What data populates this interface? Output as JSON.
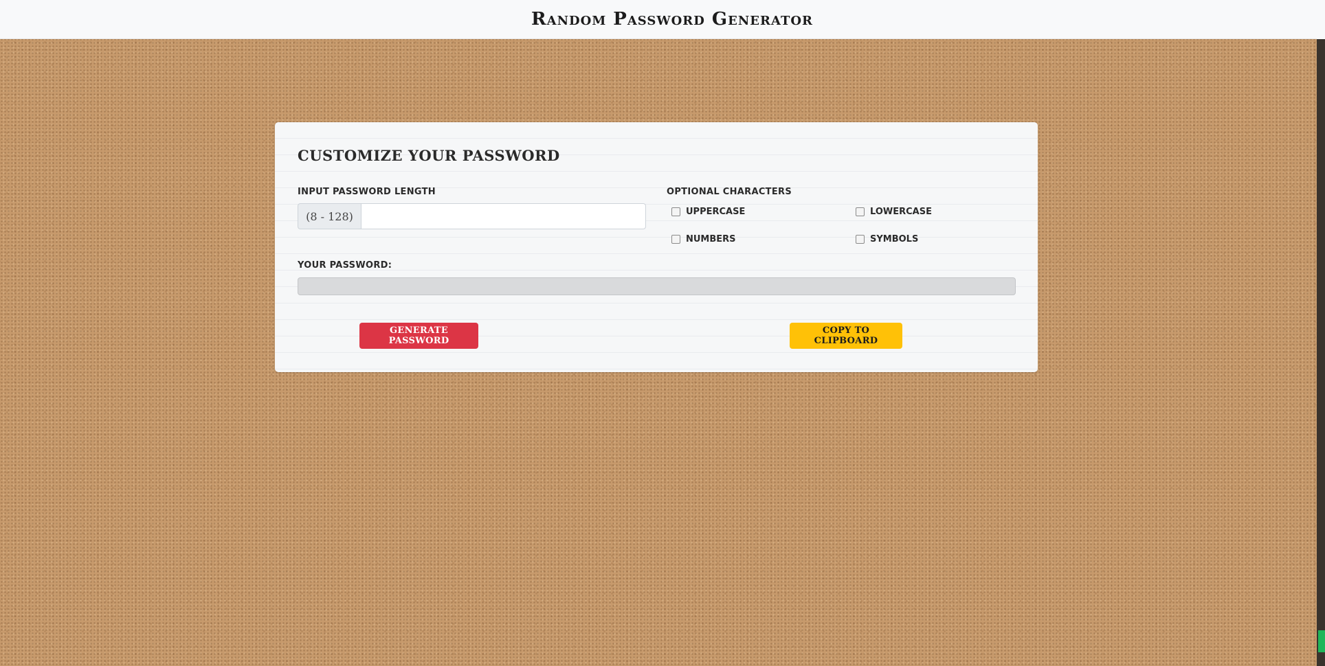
{
  "navbar": {
    "title": "Random Password Generator"
  },
  "card": {
    "title": "Customize Your Password",
    "length_label": "Input Password Length",
    "length_addon": "(8 - 128)",
    "length_value": "",
    "length_placeholder": "",
    "optional_label": "Optional Characters",
    "options": {
      "uppercase": "Uppercase",
      "lowercase": "Lowercase",
      "numbers": "Numbers",
      "symbols": "Symbols"
    },
    "password_label": "Your Password:",
    "password_value": "",
    "generate_label": "Generate Password",
    "copy_label": "Copy to Clipboard"
  },
  "colors": {
    "generate": "#dc3545",
    "copy": "#ffc107",
    "navbar": "#f8f9fa",
    "background": "#c79a6c"
  }
}
